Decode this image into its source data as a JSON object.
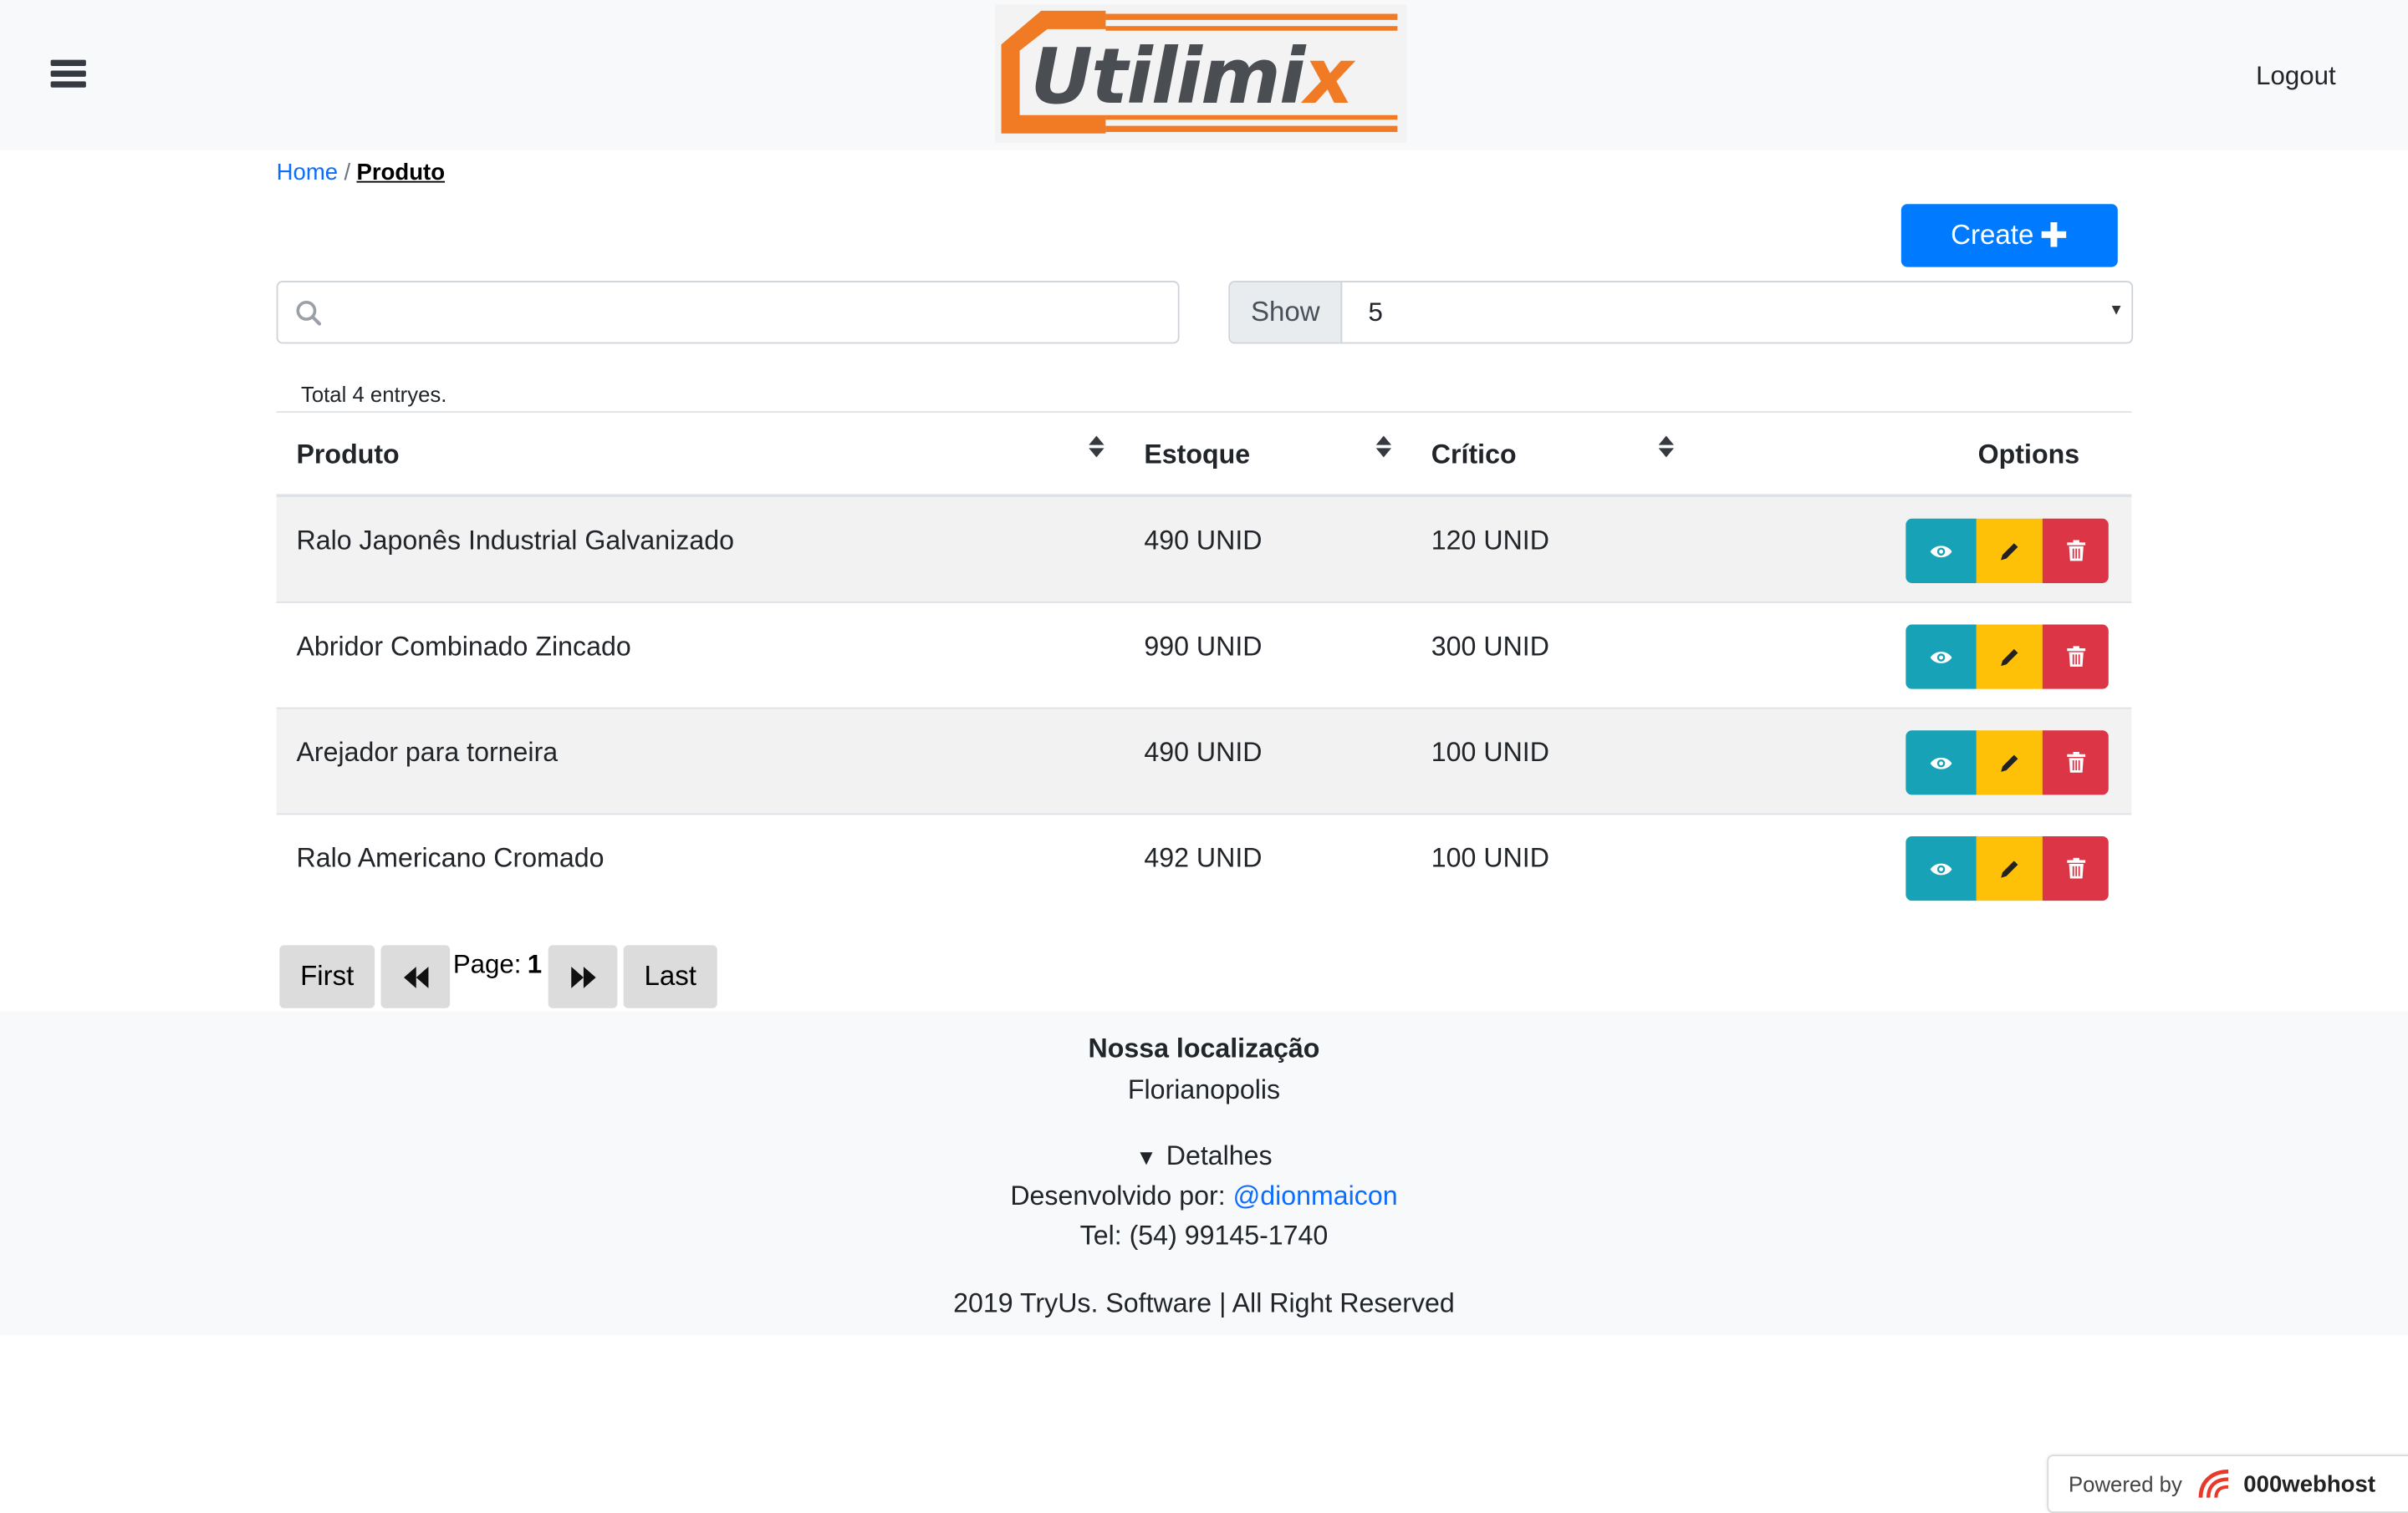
{
  "header": {
    "logo_text": "Utilimi",
    "logo_text_accent": "x",
    "logout_label": "Logout"
  },
  "breadcrumb": {
    "home": "Home",
    "separator": "/",
    "current": "Produto"
  },
  "toolbar": {
    "create_label": "Create",
    "search_placeholder": "",
    "show_label": "Show",
    "show_value": "5"
  },
  "table": {
    "total_text": "Total 4 entryes.",
    "columns": {
      "produto": "Produto",
      "estoque": "Estoque",
      "critico": "Crítico",
      "options": "Options"
    },
    "rows": [
      {
        "produto": "Ralo Japonês Industrial Galvanizado",
        "estoque": "490 UNID",
        "critico": "120 UNID"
      },
      {
        "produto": "Abridor Combinado Zincado",
        "estoque": "990 UNID",
        "critico": "300 UNID"
      },
      {
        "produto": "Arejador para torneira",
        "estoque": "490 UNID",
        "critico": "100 UNID"
      },
      {
        "produto": "Ralo Americano Cromado",
        "estoque": "492 UNID",
        "critico": "100 UNID"
      }
    ]
  },
  "pagination": {
    "first_label": "First",
    "last_label": "Last",
    "page_label": "Page:",
    "page_number": "1"
  },
  "footer": {
    "location_title": "Nossa localização",
    "city": "Florianopolis",
    "details_label": "Detalhes",
    "developed_by_label": "Desenvolvido por:",
    "developer_handle": "@dionmaicon",
    "tel": "Tel: (54) 99145-1740",
    "copyright": "2019 TryUs. Software | All Right Reserved"
  },
  "powered_badge": {
    "label": "Powered by",
    "brand": "000webhost"
  },
  "colors": {
    "primary": "#007bff",
    "info": "#17a2b8",
    "warning": "#ffc107",
    "danger": "#dc3545",
    "logo_orange": "#f07b24"
  }
}
